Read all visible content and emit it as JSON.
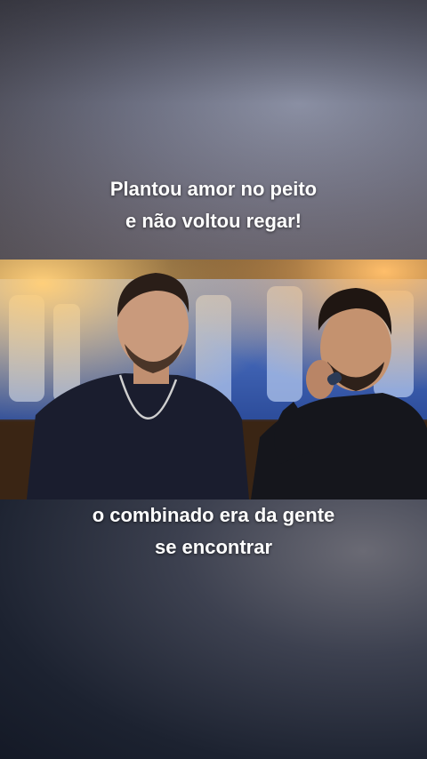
{
  "captions": {
    "top": {
      "line1": "Plantou amor no peito",
      "line2": "e não voltou regar!"
    },
    "bottom": {
      "line1": "o combinado era da gente",
      "line2": "se encontrar"
    }
  },
  "video": {
    "scene": "two singers on stage",
    "colors": {
      "backdrop": "#3b5fb0",
      "shirt_left": "#1a1d2e",
      "shirt_right": "#15161c",
      "stage_light": "#ffb347"
    }
  }
}
